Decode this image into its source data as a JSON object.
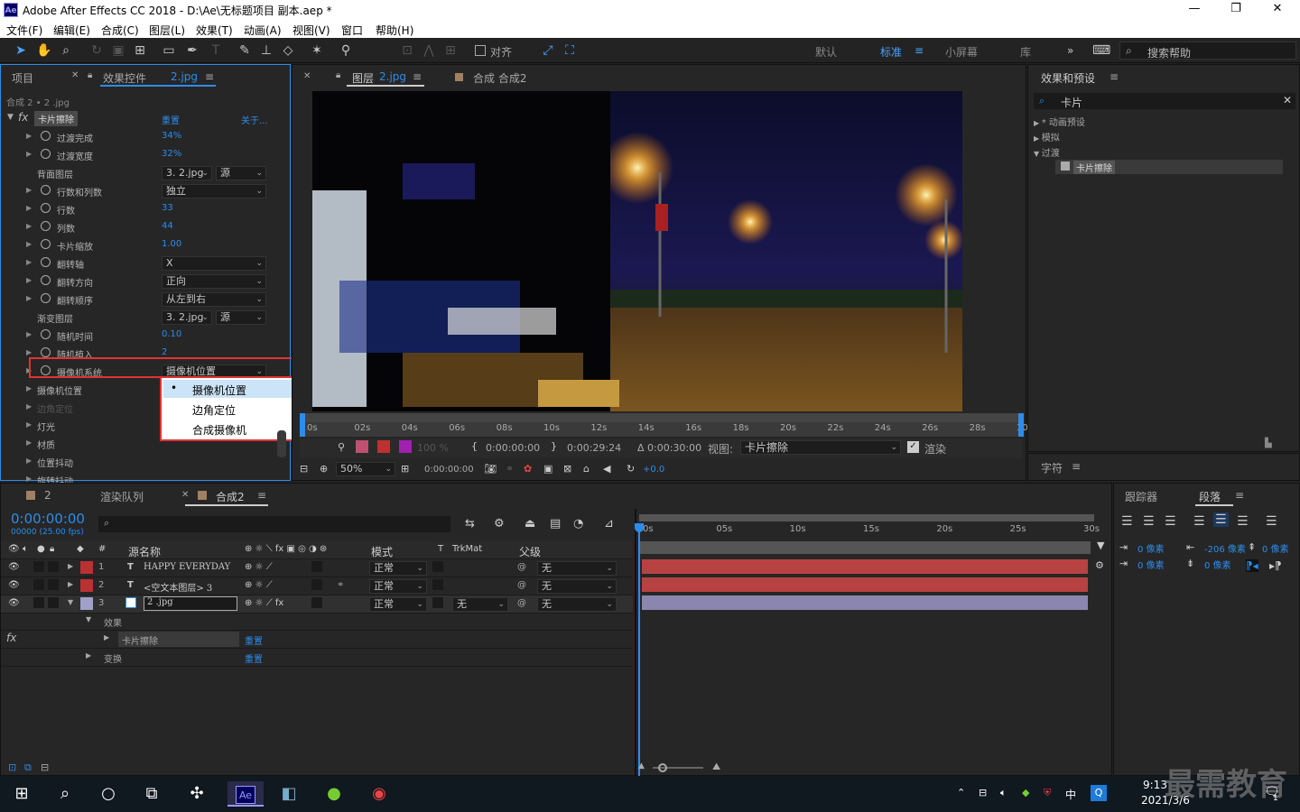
{
  "window": {
    "title": "Adobe After Effects CC 2018 - D:\\Ae\\无标题项目 副本.aep *",
    "logo": "Ae",
    "minimize": "—",
    "maximize": "❐",
    "close": "✕"
  },
  "menu": [
    "文件(F)",
    "编辑(E)",
    "合成(C)",
    "图层(L)",
    "效果(T)",
    "动画(A)",
    "视图(V)",
    "窗口",
    "帮助(H)"
  ],
  "toolbar": {
    "snap_label": "对齐",
    "workspaces": [
      "默认",
      "标准",
      "小屏幕",
      "库"
    ],
    "active_workspace": "标准",
    "search_placeholder": "搜索帮助"
  },
  "left_panel": {
    "tab_project": "项目",
    "tab_effect_controls": "效果控件",
    "tab_effect_file": "2.jpg",
    "breadcrumb": "合成 2 • 2 .jpg",
    "effect": {
      "fx": "fx",
      "name": "卡片擦除",
      "reset": "重置",
      "about": "关于..."
    },
    "props": [
      {
        "label": "过渡完成",
        "value": "34%"
      },
      {
        "label": "过渡宽度",
        "value": "32%"
      },
      {
        "label": "背面图层",
        "value": "3. 2.jpg",
        "value2": "源"
      },
      {
        "label": "行数和列数",
        "value": "独立"
      },
      {
        "label": "行数",
        "value": "33"
      },
      {
        "label": "列数",
        "value": "44"
      },
      {
        "label": "卡片缩放",
        "value": "1.00"
      },
      {
        "label": "翻转轴",
        "value": "X"
      },
      {
        "label": "翻转方向",
        "value": "正向"
      },
      {
        "label": "翻转顺序",
        "value": "从左到右"
      },
      {
        "label": "渐变图层",
        "value": "3. 2.jpg",
        "value2": "源"
      },
      {
        "label": "随机时间",
        "value": "0.10"
      },
      {
        "label": "随机植入",
        "value": "2"
      },
      {
        "label": "摄像机系统",
        "value": "摄像机位置"
      },
      {
        "label": "摄像机位置",
        "value": ""
      },
      {
        "label": "边角定位",
        "value": ""
      },
      {
        "label": "灯光",
        "value": ""
      },
      {
        "label": "材质",
        "value": ""
      },
      {
        "label": "位置抖动",
        "value": ""
      },
      {
        "label": "旋转抖动",
        "value": ""
      }
    ],
    "dropdown_options": [
      "摄像机位置",
      "边角定位",
      "合成摄像机"
    ],
    "dropdown_selected": "摄像机位置"
  },
  "viewer": {
    "tab_layer": "图层",
    "tab_layer_file": "2.jpg",
    "tab_comp": "合成 合成2",
    "ruler": [
      "0s",
      "02s",
      "04s",
      "06s",
      "08s",
      "10s",
      "12s",
      "14s",
      "16s",
      "18s",
      "20s",
      "22s",
      "24s",
      "26s",
      "28s",
      "30s"
    ],
    "opacity": "100 %",
    "in_time": "0:00:00:00",
    "out_time": "0:00:29:24",
    "duration": "Δ 0:00:30:00",
    "view_label": "视图:",
    "view_value": "卡片擦除",
    "render_label": "渲染",
    "zoom": "50%",
    "cur_time": "0:00:00:00",
    "exposure": "+0.0"
  },
  "right_panel": {
    "title": "效果和预设",
    "search_value": "卡片",
    "tree": [
      "* 动画预设",
      "模拟",
      "过渡"
    ],
    "tree_item": "卡片擦除",
    "character_title": "字符",
    "tracker_tab": "跟踪器",
    "paragraph_tab": "段落",
    "indent_values": [
      "0 像素",
      "-206 像素",
      "0 像素",
      "0 像素",
      "0 像素"
    ]
  },
  "timeline": {
    "tab_render": "渲染队列",
    "tab_comp": "合成2",
    "timecode": "0:00:00:00",
    "fps": "00000 (25.00 fps)",
    "search_placeholder": "",
    "headers": {
      "num": "#",
      "source": "源名称",
      "mode": "模式",
      "t": "T",
      "trkmat": "TrkMat",
      "parent": "父级"
    },
    "layers": [
      {
        "num": "1",
        "type": "T",
        "name": "HAPPY EVERYDAY",
        "mode": "正常",
        "trkmat": "",
        "parent": "无",
        "color": "#b83232"
      },
      {
        "num": "2",
        "type": "T",
        "name": "<空文本图层> 3",
        "mode": "正常",
        "trkmat": "",
        "parent": "无",
        "color": "#b83232"
      },
      {
        "num": "3",
        "type": "img",
        "name": "2 .jpg",
        "mode": "正常",
        "trkmat": "无",
        "parent": "无",
        "color": "#a0a0c8"
      }
    ],
    "sub_effects": "效果",
    "sub_effect_name": "卡片擦除",
    "sub_transform": "变换",
    "reset": "重置",
    "ruler": [
      "0s",
      "05s",
      "10s",
      "15s",
      "20s",
      "25s",
      "30s"
    ]
  },
  "taskbar": {
    "time": "9:13",
    "date": "2021/3/6",
    "watermark": "最需教育",
    "ime": "中",
    "notif_count": "1"
  }
}
